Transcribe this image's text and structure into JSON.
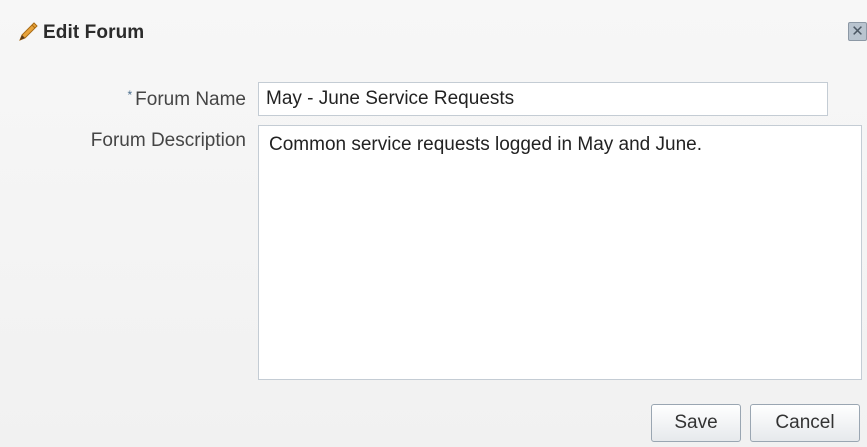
{
  "dialog": {
    "title": "Edit Forum",
    "icon": "pencil-icon",
    "close_icon": "close-icon",
    "close_glyph": "✕"
  },
  "form": {
    "required_marker": "*",
    "forum_name_label": "Forum Name",
    "forum_name_value": "May - June Service Requests",
    "forum_description_label": "Forum Description",
    "forum_description_value": "Common service requests logged in May and June."
  },
  "buttons": {
    "save_label": "Save",
    "cancel_label": "Cancel"
  },
  "colors": {
    "pencil_body": "#e8a33a",
    "pencil_tip": "#5a3a1a",
    "required_star": "#4a6d8c",
    "input_border": "#c4ccd4"
  }
}
